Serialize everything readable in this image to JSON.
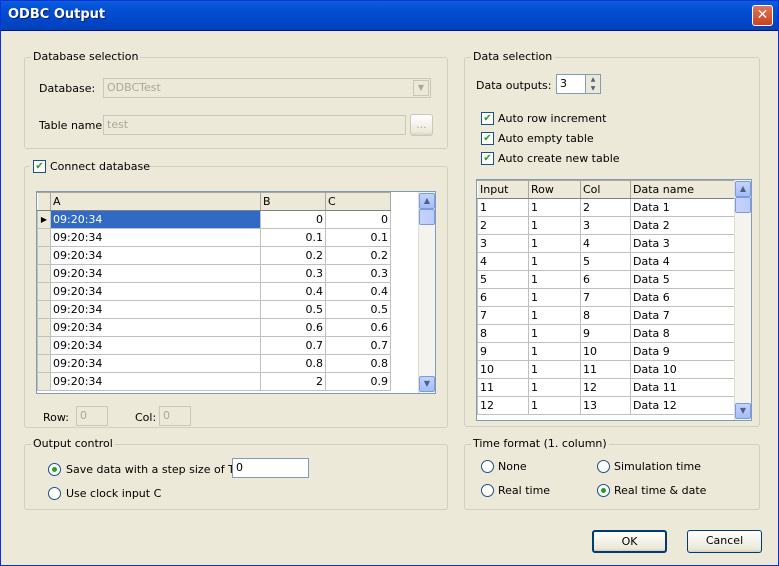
{
  "window": {
    "title": "ODBC Output",
    "close_glyph": "✕"
  },
  "database_selection": {
    "group_title": "Database selection",
    "database_label": "Database:",
    "database_value": "ODBCTest",
    "table_name_label": "Table name:",
    "table_name_value": "test",
    "browse_label": "..."
  },
  "connect": {
    "label": "Connect database",
    "checked": true,
    "grid": {
      "columns": [
        "A",
        "B",
        "C"
      ],
      "rows": [
        [
          "09:20:34",
          "0",
          "0"
        ],
        [
          "09:20:34",
          "0.1",
          "0.1"
        ],
        [
          "09:20:34",
          "0.2",
          "0.2"
        ],
        [
          "09:20:34",
          "0.3",
          "0.3"
        ],
        [
          "09:20:34",
          "0.4",
          "0.4"
        ],
        [
          "09:20:34",
          "0.5",
          "0.5"
        ],
        [
          "09:20:34",
          "0.6",
          "0.6"
        ],
        [
          "09:20:34",
          "0.7",
          "0.7"
        ],
        [
          "09:20:34",
          "0.8",
          "0.8"
        ],
        [
          "09:20:34",
          "2",
          "0.9"
        ]
      ],
      "current_marker": "▶"
    },
    "row_label": "Row:",
    "row_value": "0",
    "col_label": "Col:",
    "col_value": "0"
  },
  "output_control": {
    "group_title": "Output control",
    "step_label": "Save data with a step size of T =",
    "step_value": "0",
    "step_selected": true,
    "clock_label": "Use clock input C",
    "clock_selected": false
  },
  "data_selection": {
    "group_title": "Data selection",
    "outputs_label": "Data outputs:",
    "outputs_value": "3",
    "auto_row_increment": "Auto row increment",
    "auto_empty_table": "Auto empty table",
    "auto_create_new_table": "Auto create new table",
    "grid": {
      "columns": [
        "Input",
        "Row",
        "Col",
        "Data name"
      ],
      "rows": [
        [
          "1",
          "1",
          "2",
          "Data 1"
        ],
        [
          "2",
          "1",
          "3",
          "Data 2"
        ],
        [
          "3",
          "1",
          "4",
          "Data 3"
        ],
        [
          "4",
          "1",
          "5",
          "Data 4"
        ],
        [
          "5",
          "1",
          "6",
          "Data 5"
        ],
        [
          "6",
          "1",
          "7",
          "Data 6"
        ],
        [
          "7",
          "1",
          "8",
          "Data 7"
        ],
        [
          "8",
          "1",
          "9",
          "Data 8"
        ],
        [
          "9",
          "1",
          "10",
          "Data 9"
        ],
        [
          "10",
          "1",
          "11",
          "Data 10"
        ],
        [
          "11",
          "1",
          "12",
          "Data 11"
        ],
        [
          "12",
          "1",
          "13",
          "Data 12"
        ]
      ]
    }
  },
  "time_format": {
    "group_title": "Time format (1. column)",
    "none": "None",
    "simulation_time": "Simulation time",
    "real_time": "Real time",
    "real_time_date": "Real time & date",
    "selected": "real_time_date"
  },
  "buttons": {
    "ok": "OK",
    "cancel": "Cancel"
  },
  "icons": {
    "dropdown": "chevron-down-icon",
    "scroll_up": "arrow-up-icon",
    "scroll_down": "arrow-down-icon",
    "spin_up": "triangle-up-icon",
    "spin_down": "triangle-down-icon",
    "check": "checkmark-icon"
  },
  "colors": {
    "title_bar": "#0450d6",
    "selection": "#316ac5",
    "dialog_bg": "#ece9d8"
  }
}
